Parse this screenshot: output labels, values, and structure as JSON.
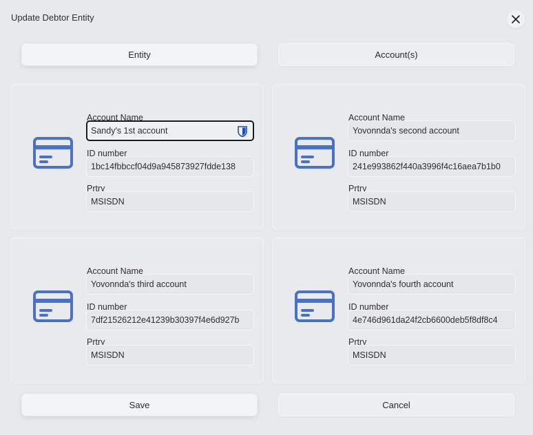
{
  "dialog": {
    "title": "Update Debtor Entity",
    "close_icon": "close-icon"
  },
  "tabs": [
    {
      "label": "Entity",
      "active": true
    },
    {
      "label": "Account(s)",
      "active": false
    }
  ],
  "labels": {
    "account_name": "Account Name",
    "id_number": "ID number",
    "prtry": "Prtry"
  },
  "accounts": [
    {
      "name": "Sandy's 1st account",
      "id": "1bc14fbbccf04d9a945873927fdde138",
      "prtry": "MSISDN",
      "focused": true
    },
    {
      "name": "Yovonnda's second account",
      "id": "241e993862f440a3996f4c16aea7b1b0",
      "prtry": "MSISDN",
      "focused": false
    },
    {
      "name": "Yovonnda's third account",
      "id": "7df21526212e41239b30397f4e6d927b",
      "prtry": "MSISDN",
      "focused": false
    },
    {
      "name": "Yovonnda's fourth account",
      "id": "4e746d961da24f2cb6600deb5f8df8c4",
      "prtry": "MSISDN",
      "focused": false
    }
  ],
  "buttons": {
    "save": "Save",
    "cancel": "Cancel"
  },
  "colors": {
    "accent": "#4a72c4",
    "background": "#e8e9ed"
  }
}
